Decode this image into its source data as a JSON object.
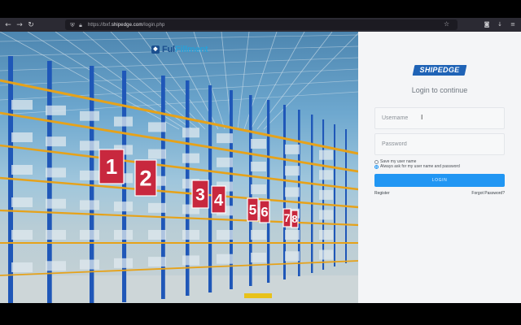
{
  "browser": {
    "url_prefix": "https://bxf.",
    "url_domain": "shipedge.com",
    "url_path": "/login.php",
    "icons": {
      "back": "back-arrow-icon",
      "forward": "forward-arrow-icon",
      "reload": "reload-icon",
      "shield": "shield-icon",
      "lock": "lock-icon",
      "bookmark": "star-icon",
      "pocket": "pocket-icon",
      "downloads": "download-icon",
      "menu": "hamburger-menu-icon"
    }
  },
  "hero": {
    "logo_main": "Ful",
    "logo_accent": "Fillment",
    "bay_numbers": [
      "1",
      "2",
      "3",
      "4",
      "5",
      "6",
      "7",
      "8"
    ]
  },
  "login": {
    "brand": "SHIPEDGE",
    "title": "Login to continue",
    "username_placeholder": "Username",
    "password_placeholder": "Password",
    "save_username_label": "Save my user name",
    "always_ask_label": "Always ask for my user name and password",
    "save_username_checked": false,
    "always_ask_checked": true,
    "login_button": "LOGIN",
    "register_link": "Register",
    "forgot_link": "Forgot Password?"
  },
  "colors": {
    "primary_button": "#2196f3",
    "brand_blue": "#1f63b6",
    "bay_sign_red": "#c8283e",
    "rack_blue": "#1f57b8",
    "rack_orange": "#e6a21a"
  }
}
